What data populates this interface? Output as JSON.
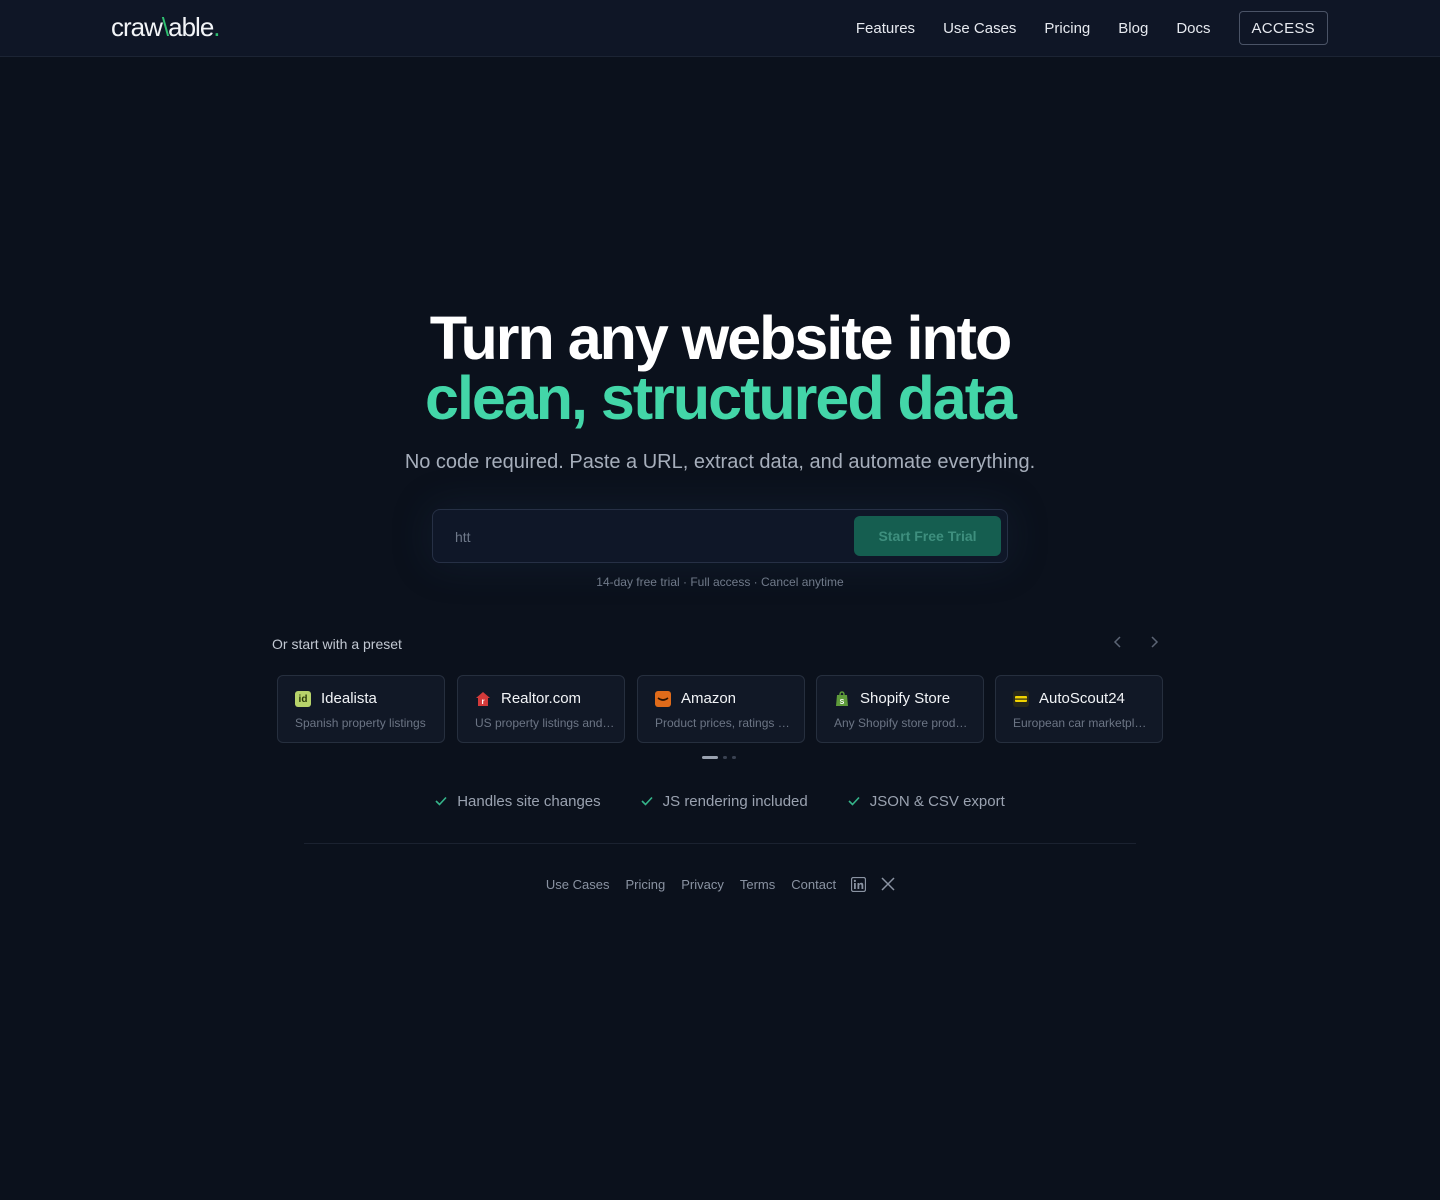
{
  "header": {
    "logo": {
      "part1": "craw",
      "slash": "\\",
      "part2": "able",
      "dot": "."
    },
    "nav": [
      {
        "label": "Features"
      },
      {
        "label": "Use Cases"
      },
      {
        "label": "Pricing"
      },
      {
        "label": "Blog"
      },
      {
        "label": "Docs"
      }
    ],
    "access_label": "ACCESS"
  },
  "hero": {
    "title_line1": "Turn any website into",
    "title_line2": "clean, structured data",
    "subtitle": "No code required. Paste a URL, extract data, and automate everything.",
    "url_input_value": "htt",
    "cta_label": "Start Free Trial",
    "trial_note": "14-day free trial · Full access · Cancel anytime"
  },
  "presets": {
    "label": "Or start with a preset",
    "prev_icon": "chevron-left-icon",
    "next_icon": "chevron-right-icon",
    "items": [
      {
        "name": "Idealista",
        "desc": "Spanish property listings",
        "icon": "idealista-icon",
        "icon_text": "id",
        "icon_color": "#b7d36a"
      },
      {
        "name": "Realtor.com",
        "desc": "US property listings and prices",
        "icon": "realtor-icon",
        "icon_text": "r",
        "icon_color": "#d33a3a"
      },
      {
        "name": "Amazon",
        "desc": "Product prices, ratings and reviews",
        "icon": "amazon-icon",
        "icon_text": "a",
        "icon_color": "#e06b1a"
      },
      {
        "name": "Shopify Store",
        "desc": "Any Shopify store products",
        "icon": "shopify-icon",
        "icon_text": "s",
        "icon_color": "#5e9b3a"
      },
      {
        "name": "AutoScout24",
        "desc": "European car marketplace listings",
        "icon": "autoscout-icon",
        "icon_text": "a",
        "icon_color": "#f2d400"
      }
    ],
    "pager": {
      "pages": 3,
      "active": 0
    }
  },
  "features": [
    {
      "label": "Handles site changes"
    },
    {
      "label": "JS rendering included"
    },
    {
      "label": "JSON & CSV export"
    }
  ],
  "footer": {
    "links": [
      {
        "label": "Use Cases"
      },
      {
        "label": "Pricing"
      },
      {
        "label": "Privacy"
      },
      {
        "label": "Terms"
      },
      {
        "label": "Contact"
      }
    ],
    "social": [
      "linkedin-icon",
      "x-icon"
    ]
  },
  "colors": {
    "background": "#0b111c",
    "accent": "#43d6a8",
    "logo_accent": "#2fbf71",
    "cta_bg": "#155e50"
  }
}
